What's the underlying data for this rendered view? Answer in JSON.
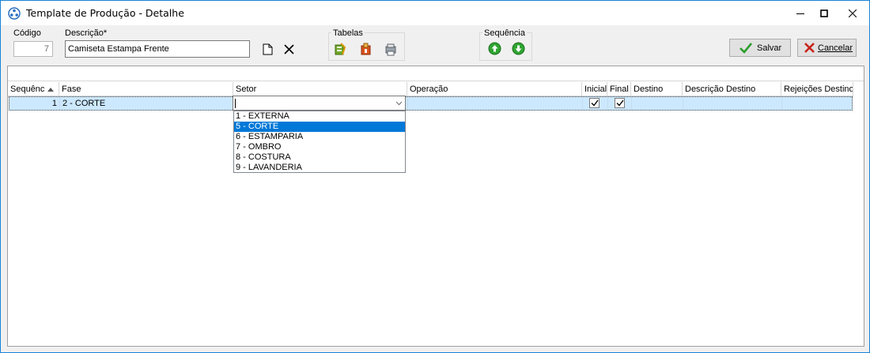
{
  "window": {
    "title": "Template de Produção - Detalhe"
  },
  "form": {
    "codigo_label": "Código",
    "codigo_value": "7",
    "descricao_label": "Descrição*",
    "descricao_value": "Camiseta Estampa Frente"
  },
  "groups": {
    "tabelas_label": "Tabelas",
    "sequencia_label": "Sequência"
  },
  "buttons": {
    "salvar_label": "Salvar",
    "cancelar_label": "Cancelar"
  },
  "colors": {
    "accent": "#0078d7",
    "row_selected": "#cce8ff",
    "window_border": "#1883d7"
  },
  "grid": {
    "columns": [
      "Sequênc",
      "Fase",
      "Setor",
      "Operação",
      "Inicial",
      "Final",
      "Destino",
      "Descrição Destino",
      "Rejeições Destino"
    ],
    "sort_column": "Sequênc",
    "sort_direction": "ascending",
    "rows": [
      {
        "sequencia": "1",
        "fase": "2 - CORTE",
        "setor": "",
        "operacao": "",
        "inicial": true,
        "final": true,
        "destino": "",
        "descricao_destino": "",
        "rejeicoes_destino": ""
      }
    ]
  },
  "setor_dropdown": {
    "options": [
      "1 - EXTERNA",
      "5 - CORTE",
      "6 - ESTAMPARIA",
      "7 - OMBRO",
      "8 - COSTURA",
      "9 - LAVANDERIA"
    ],
    "highlighted": "5 - CORTE"
  },
  "icons": [
    "app-icon",
    "minimize-icon",
    "maximize-icon",
    "close-icon",
    "new-document-icon",
    "clear-x-icon",
    "table-edit-icon",
    "table-box-icon",
    "table-print-icon",
    "arrow-up-icon",
    "arrow-down-icon",
    "checkmark-icon",
    "cancel-x-icon",
    "sort-ascending-icon",
    "chevron-down-icon"
  ]
}
